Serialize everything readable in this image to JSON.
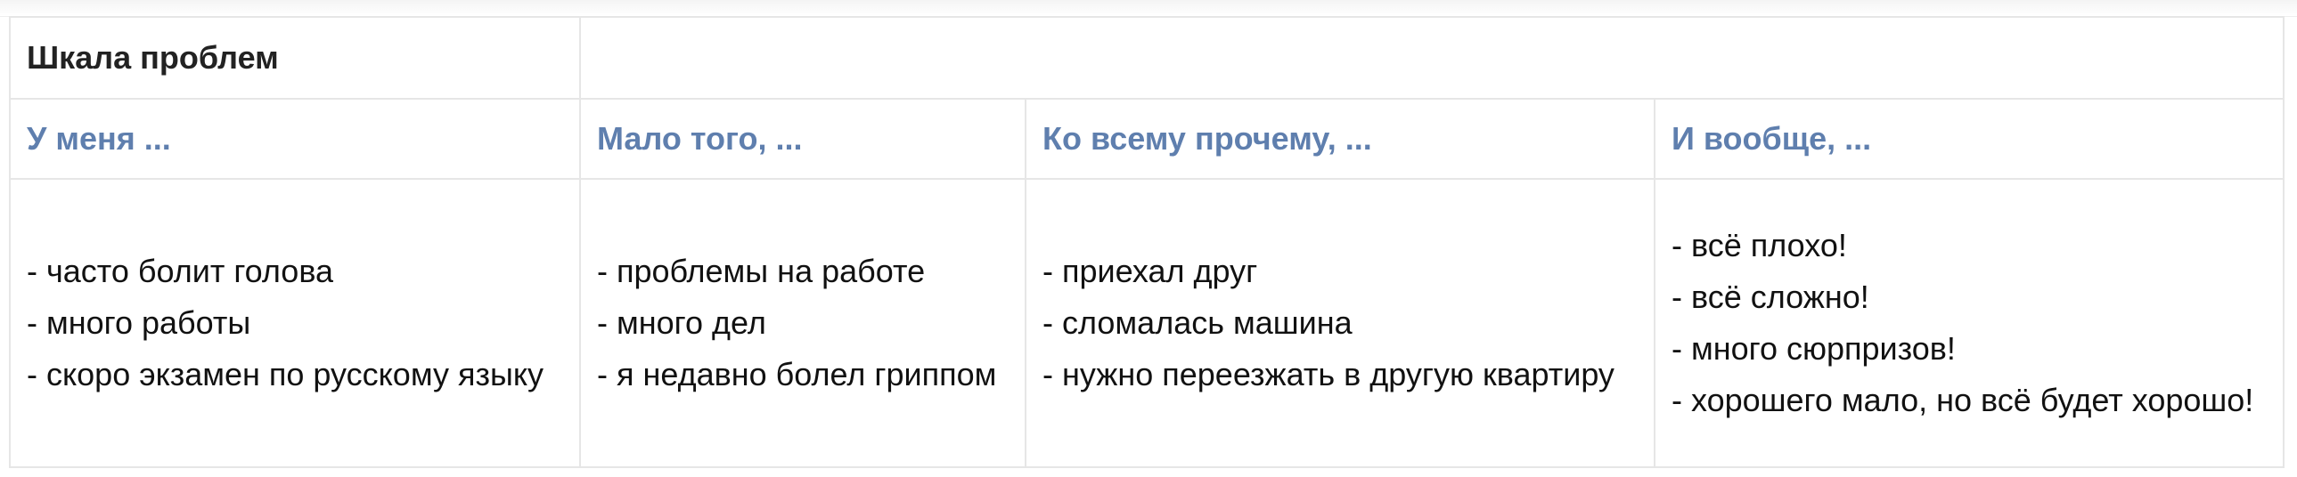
{
  "table": {
    "title": "Шкала проблем",
    "columns": [
      {
        "heading": "У меня ...",
        "items": [
          "- часто болит голова",
          "- много работы",
          "- скоро экзамен по русскому языку"
        ]
      },
      {
        "heading": "Мало того, ...",
        "items": [
          "- проблемы на работе",
          "- много дел",
          "- я недавно болел гриппом"
        ]
      },
      {
        "heading": "Ко всему прочему, ...",
        "items": [
          "- приехал друг",
          "- сломалась машина",
          "- нужно переезжать в другую квартиру"
        ]
      },
      {
        "heading": "И вообще, ...",
        "items": [
          "- всё плохо!",
          "- всё сложно!",
          "- много сюрпризов!",
          "- хорошего мало, но всё будет хорошо!"
        ]
      }
    ]
  },
  "colors": {
    "heading": "#5f7fae",
    "border": "#e6e6e6",
    "text": "#111111"
  }
}
